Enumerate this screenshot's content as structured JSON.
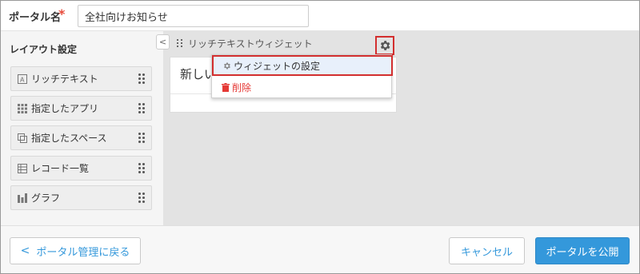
{
  "header": {
    "portal_name_label": "ポータル名",
    "required_mark": "*",
    "portal_name_value": "全社向けお知らせ"
  },
  "sidebar": {
    "title": "レイアウト設定",
    "collapse_glyph": "<",
    "items": [
      {
        "label": "リッチテキスト",
        "icon": "rich-text-icon"
      },
      {
        "label": "指定したアプリ",
        "icon": "app-grid-icon"
      },
      {
        "label": "指定したスペース",
        "icon": "space-icon"
      },
      {
        "label": "レコード一覧",
        "icon": "table-icon"
      },
      {
        "label": "グラフ",
        "icon": "graph-icon"
      }
    ]
  },
  "canvas": {
    "widget": {
      "title": "リッチテキストウィジェット",
      "body_text": "新しい"
    },
    "menu": {
      "settings_label": "ウィジェットの設定",
      "delete_label": "削除"
    }
  },
  "footer": {
    "back_label": "ポータル管理に戻る",
    "back_glyph": "<",
    "cancel_label": "キャンセル",
    "publish_label": "ポータルを公開"
  },
  "colors": {
    "accent": "#3498db",
    "highlight_red": "#d32f2f",
    "delete_red": "#e53935",
    "sidebar_bg": "#f5f5f5",
    "canvas_bg": "#e3e3e3"
  }
}
